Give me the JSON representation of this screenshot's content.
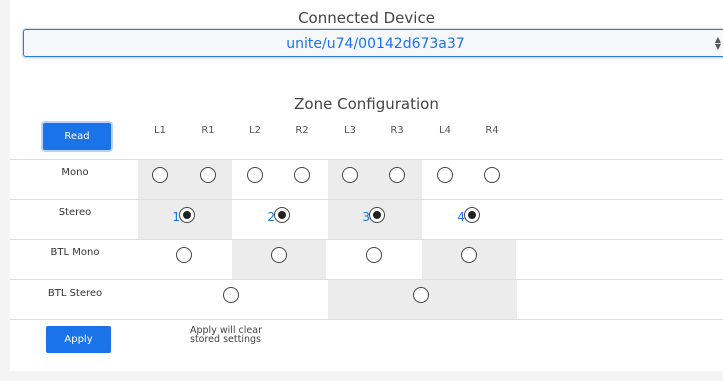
{
  "connected_device": {
    "title": "Connected Device",
    "selected_value": "unite/u74/00142d673a37",
    "select_arrows": "▲▼"
  },
  "zone_configuration": {
    "title": "Zone Configuration",
    "read_label": "Read",
    "apply_label": "Apply",
    "apply_note_line1": "Apply will clear",
    "apply_note_line2": "stored settings",
    "columns": [
      "L1",
      "R1",
      "L2",
      "R2",
      "L3",
      "R3",
      "L4",
      "R4"
    ],
    "rows": {
      "mono": {
        "label": "Mono",
        "selected": []
      },
      "stereo": {
        "label": "Stereo",
        "numbers": [
          "1",
          "2",
          "3",
          "4"
        ],
        "selected": [
          1,
          2,
          3,
          4
        ]
      },
      "btl_mono": {
        "label": "BTL Mono",
        "selected": []
      },
      "btl_stereo": {
        "label": "BTL Stereo",
        "selected": []
      }
    }
  },
  "colors": {
    "accent": "#1a73e8",
    "shade": "#ececec"
  }
}
